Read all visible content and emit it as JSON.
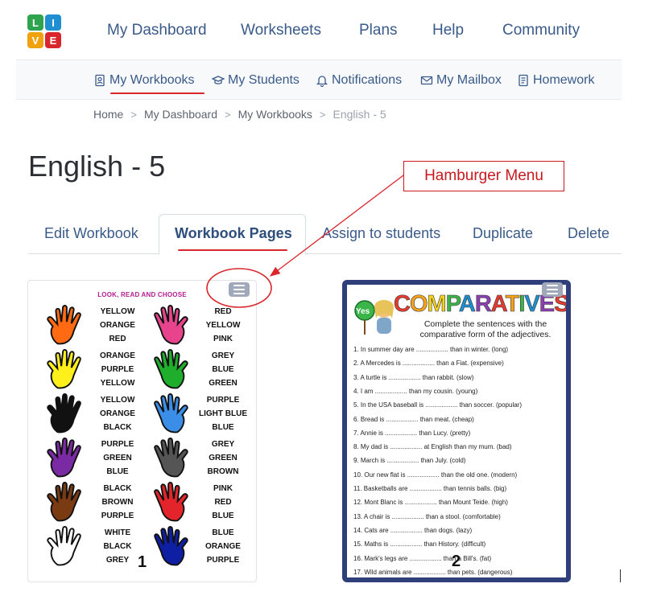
{
  "logo": {
    "letters": [
      "L",
      "I",
      "V",
      "E"
    ],
    "colors": [
      "#2ea44f",
      "#1f8fd1",
      "#f0a20e",
      "#d9262c"
    ]
  },
  "topnav": [
    "My Dashboard",
    "Worksheets",
    "Plans",
    "Help",
    "Community"
  ],
  "subnav": {
    "my_workbooks": "My Workbooks",
    "my_students": "My Students",
    "notifications": "Notifications",
    "my_mailbox": "My Mailbox",
    "homework": "Homework"
  },
  "breadcrumb": {
    "home": "Home",
    "dashboard": "My Dashboard",
    "workbooks": "My Workbooks",
    "current": "English - 5",
    "sep": ">"
  },
  "page_title": "English - 5",
  "callout": "Hamburger  Menu",
  "tabs": {
    "edit": "Edit Workbook",
    "pages": "Workbook Pages",
    "assign": "Assign to students",
    "duplicate": "Duplicate",
    "delete": "Delete"
  },
  "page1": {
    "heading": "LOOK, READ AND CHOOSE",
    "number": "1",
    "left": [
      {
        "color": "#ff6a13",
        "words": [
          "YELLOW",
          "ORANGE",
          "RED"
        ]
      },
      {
        "color": "#ffef1a",
        "words": [
          "ORANGE",
          "PURPLE",
          "YELLOW"
        ]
      },
      {
        "color": "#111111",
        "words": [
          "YELLOW",
          "ORANGE",
          "BLACK"
        ]
      },
      {
        "color": "#7a2aa3",
        "words": [
          "PURPLE",
          "GREEN",
          "BLUE"
        ]
      },
      {
        "color": "#7a3b12",
        "words": [
          "BLACK",
          "BROWN",
          "PURPLE"
        ]
      },
      {
        "color": "#ffffff",
        "words": [
          "WHITE",
          "BLACK",
          "GREY"
        ]
      }
    ],
    "right": [
      {
        "color": "#e8448e",
        "words": [
          "RED",
          "YELLOW",
          "PINK"
        ]
      },
      {
        "color": "#1fae2c",
        "words": [
          "GREY",
          "BLUE",
          "GREEN"
        ]
      },
      {
        "color": "#3b8ee8",
        "words": [
          "PURPLE",
          "LIGHT BLUE",
          "BLUE"
        ]
      },
      {
        "color": "#555555",
        "words": [
          "GREY",
          "GREEN",
          "BROWN"
        ]
      },
      {
        "color": "#e3252b",
        "words": [
          "PINK",
          "RED",
          "BLUE"
        ]
      },
      {
        "color": "#0e1fa3",
        "words": [
          "BLUE",
          "ORANGE",
          "PURPLE"
        ]
      }
    ]
  },
  "page2": {
    "badge": "Yes",
    "title": "COMPARATIVES",
    "title_colors": [
      "#e63b2e",
      "#f7a21b",
      "#f5d31a",
      "#3bb54a",
      "#1f8fd1",
      "#8b3fb3",
      "#e63b2e",
      "#f7a21b",
      "#3bb54a",
      "#1f8fd1",
      "#8b3fb3",
      "#e63b2e"
    ],
    "instructions": "Complete the sentences with the comparative form of the adjectives.",
    "number": "2",
    "sentences": [
      "1. In summer day are .................. than in winter. (long)",
      "2. A Mercedes is .................. than a Fiat. (expensive)",
      "3. A turtle is .................. than rabbit. (slow)",
      "4. I am .................. than my cousin. (young)",
      "5. In the USA baseball is .................. than soccer. (popular)",
      "6. Bread is .................. than meat. (cheap)",
      "7. Annie is .................. than Lucy. (pretty)",
      "8. My dad is .................. at English than my mum. (bad)",
      "9. March is .................. than July. (cold)",
      "10.  Our new flat is .................. than the old one. (modern)",
      "11.  Basketballs are .................. than tennis balls. (big)",
      "12.  Mont Blanc is .................. than Mount Teide. (high)",
      "13.  A chair is .................. than a stool. (comfortable)",
      "14.  Cats are .................. than dogs. (lazy)",
      "15.  Maths is .................. than History. (difficult)",
      "16.  Mark's legs are .................. than a Bill's. (fat)",
      "17.  Wild animals are .................. than pets. (dangerous)"
    ]
  },
  "colors": {
    "nav": "#3a5a89",
    "annotation": "#d9262c",
    "hamburger": "#9fa9b9",
    "card2_border": "#2f3f7a"
  }
}
